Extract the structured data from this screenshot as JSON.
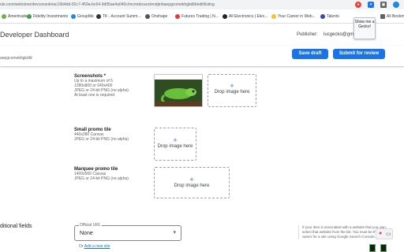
{
  "browser": {
    "url": "ole.com/webstore/devconsole/ac16b4dd-92c7-459a-bc64-9d95ae4a040c/mcmdocaoclendjmbaepgcomekhgkdld/edit/listing",
    "bookmarks": [
      "Ameritrade",
      "Fidelity Investments",
      "GroupMe",
      "TK - Account Summ...",
      "Onshape",
      "Futures Trading | N...",
      "All Electronics | Elec...",
      "Your Career in Web...",
      "Talents",
      "All Bookm"
    ],
    "tooltip": "Show me a Gecko!"
  },
  "header": {
    "title": "Developer Dashboard",
    "publisher_label": "Publisher:",
    "publisher_value": "lucgecko@gmail"
  },
  "subbar": {
    "extension_id": "aepgcomekhgkdld",
    "save_draft": "Save draft",
    "submit": "Submit for review"
  },
  "screenshots": {
    "title": "Screenshots *",
    "desc": [
      "Up to a maximum of 5",
      "1280x800 or 640x400",
      "JPEG or 24-bit PNG (no alpha)",
      "At least one is required"
    ],
    "drop_label": "Drop image here"
  },
  "small_promo": {
    "title": "Small promo tile",
    "desc": [
      "440x280 Canvas",
      "JPEG or 24-bit PNG (no alpha)"
    ],
    "drop_label": "Drop image here"
  },
  "marquee_promo": {
    "title": "Marquee promo tile",
    "desc": [
      "1400x560 Canvas",
      "JPEG or 24-bit PNG (no alpha)"
    ],
    "drop_label": "Drop image here"
  },
  "additional": {
    "title": "ditional fields",
    "official_url_label": "Official URL",
    "official_url_value": "None",
    "or_text": "Or",
    "add_site_link": "Add a new site",
    "help_lines": [
      "If your item is associated with a website that you own,",
      "select that website from the list. You must be the",
      "owner for a site using Google Search Console."
    ]
  },
  "colors": {
    "accent": "#1a73e8",
    "gecko_green": "#6abf3a"
  }
}
